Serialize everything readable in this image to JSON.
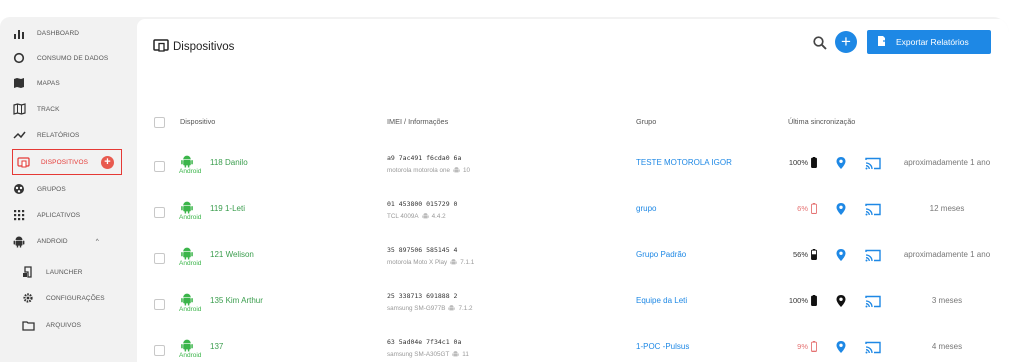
{
  "sidebar": {
    "items": [
      {
        "label": "DASHBOARD",
        "icon": "bar-chart-icon"
      },
      {
        "label": "CONSUMO DE DADOS",
        "icon": "circle-ring-icon"
      },
      {
        "label": "MAPAS",
        "icon": "map-icon"
      },
      {
        "label": "TRACK",
        "icon": "track-map-icon"
      },
      {
        "label": "RELATÓRIOS",
        "icon": "trend-line-icon"
      },
      {
        "label": "DISPOSITIVOS",
        "icon": "devices-icon",
        "active": true
      },
      {
        "label": "GRUPOS",
        "icon": "groups-icon"
      },
      {
        "label": "APLICATIVOS",
        "icon": "apps-grid-icon"
      },
      {
        "label": "ANDROID",
        "icon": "android-icon"
      },
      {
        "label": "LAUNCHER",
        "icon": "launcher-icon"
      },
      {
        "label": "CONFIGURAÇÕES",
        "icon": "gear-icon"
      },
      {
        "label": "ARQUIVOS",
        "icon": "folder-icon"
      }
    ],
    "active_badge": "+",
    "chevron": "^"
  },
  "header": {
    "title": "Dispositivos",
    "add_label": "+",
    "export_label": "Exportar Relatórios"
  },
  "table": {
    "columns": {
      "device": "Dispositivo",
      "imei": "IMEI / Informações",
      "group": "Grupo",
      "sync": "Última sincronização"
    },
    "rows": [
      {
        "name": "118 Danilo",
        "os": "Android",
        "imei": "a9 7ac491 f6cda0 6a",
        "model": "motorola motorola one",
        "version": "10",
        "group": "TESTE MOTOROLA IGOR",
        "battery": "100%",
        "battery_level": 1.0,
        "battery_color": "#111111",
        "pin_color": "#1e88e5",
        "sync": "aproximadamente 1 ano"
      },
      {
        "name": "119 1-Leti",
        "os": "Android",
        "imei": "01 453800 015729 0",
        "model": "TCL 4009A",
        "version": "4.4.2",
        "group": "grupo",
        "battery": "6%",
        "battery_level": 0.06,
        "battery_color": "#e57373",
        "pin_color": "#1e88e5",
        "sync": "12 meses"
      },
      {
        "name": "121 Welison",
        "os": "Android",
        "imei": "35 897506 585145 4",
        "model": "motorola Moto X Play",
        "version": "7.1.1",
        "group": "Grupo Padrão",
        "battery": "56%",
        "battery_level": 0.56,
        "battery_color": "#111111",
        "pin_color": "#1e88e5",
        "sync": "aproximadamente 1 ano"
      },
      {
        "name": "135 Kim Arthur",
        "os": "Android",
        "imei": "25 338713 691888 2",
        "model": "samsung SM-G977B",
        "version": "7.1.2",
        "group": "Equipe da Leti",
        "battery": "100%",
        "battery_level": 1.0,
        "battery_color": "#111111",
        "pin_color": "#111111",
        "sync": "3 meses"
      },
      {
        "name": "137",
        "os": "Android",
        "imei": "63 5ad04e 7f34c1 0a",
        "model": "samsung SM-A305GT",
        "version": "11",
        "group": "1-POC -Pulsus",
        "battery": "9%",
        "battery_level": 0.09,
        "battery_color": "#e57373",
        "pin_color": "#1e88e5",
        "sync": "4 meses"
      }
    ]
  },
  "colors": {
    "accent": "#1e88e5",
    "android": "#3bb54a",
    "active": "#e53935"
  }
}
